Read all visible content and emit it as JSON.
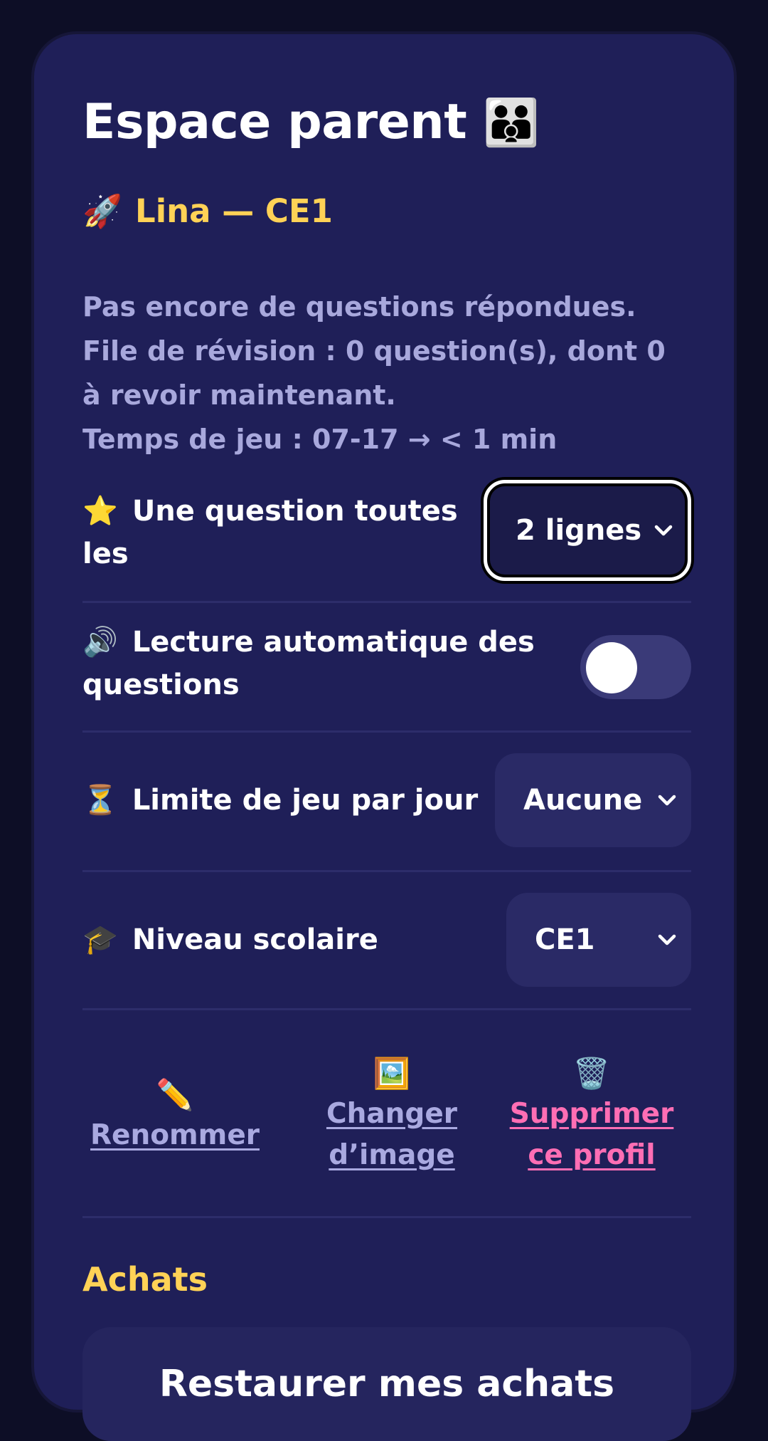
{
  "header": {
    "title": "Espace parent",
    "title_emoji": "👪"
  },
  "child": {
    "emoji": "🚀",
    "name": "Lina — CE1"
  },
  "stats": {
    "line1": "Pas encore de questions répondues.",
    "line2": "File de révision : 0 question(s), dont 0 à revoir maintenant.",
    "line3": "Temps de jeu : 07-17 → < 1 min"
  },
  "settings": {
    "frequency": {
      "emoji": "⭐",
      "label": "Une question toutes les",
      "value": "2 lignes"
    },
    "autoread": {
      "emoji": "🔊",
      "label": "Lecture automatique des questions",
      "enabled": false
    },
    "daily_limit": {
      "emoji": "⏳",
      "label": "Limite de jeu par jour",
      "value": "Aucune"
    },
    "grade": {
      "emoji": "🎓",
      "label": "Niveau scolaire",
      "value": "CE1"
    }
  },
  "actions": {
    "rename": {
      "icon": "✏️",
      "label": "Renommer"
    },
    "change_image": {
      "icon": "🖼️",
      "label": "Changer d’image"
    },
    "delete": {
      "icon": "🗑️",
      "label": "Supprimer ce profil"
    }
  },
  "purchases": {
    "title": "Achats",
    "restore_label": "Restaurer mes achats"
  },
  "colors": {
    "background": "#0d0e26",
    "card": "#1f1f58",
    "accent_yellow": "#ffd256",
    "muted_text": "#a8a8dc",
    "danger_pink": "#ff6eb4"
  }
}
